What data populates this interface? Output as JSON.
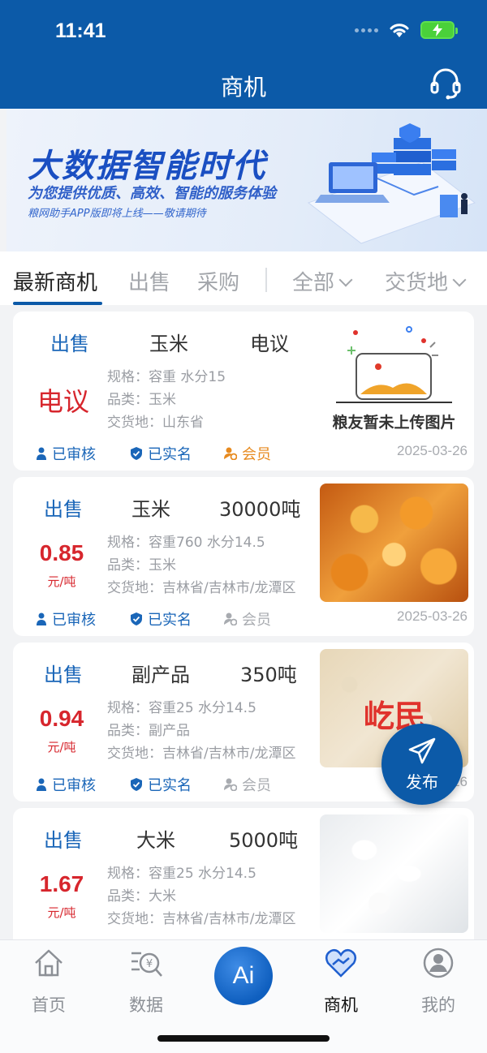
{
  "status_bar": {
    "time": "11:41"
  },
  "header": {
    "title": "商机"
  },
  "banner": {
    "title": "大数据智能时代",
    "subtitle": "为您提供优质、高效、智能的服务体验",
    "note": "粮网助手APP版即将上线——敬请期待"
  },
  "tabs": {
    "latest": "最新商机",
    "sell": "出售",
    "buy": "采购",
    "all": "全部",
    "delivery": "交货地"
  },
  "labels": {
    "spec_prefix": "规格：",
    "category_prefix": "品类：",
    "delivery_prefix": "交货地：",
    "verified": "已审核",
    "real_name": "已实名",
    "member": "会员"
  },
  "cards": [
    {
      "type": "出售",
      "name": "玉米",
      "quantity": "电议",
      "price": "电议",
      "unit": "",
      "spec": "规格：容重 水分15",
      "category": "品类：玉米",
      "delivery": "交货地：山东省",
      "image_caption": "粮友暂未上传图片",
      "verified": "已审核",
      "real_name": "已实名",
      "member": "会员",
      "date": "2025-03-26"
    },
    {
      "type": "出售",
      "name": "玉米",
      "quantity": "30000吨",
      "price": "0.85",
      "unit": "元/吨",
      "spec": "规格：容重760 水分14.5",
      "category": "品类：玉米",
      "delivery": "交货地：吉林省/吉林市/龙潭区",
      "verified": "已审核",
      "real_name": "已实名",
      "member": "会员",
      "date": "2025-03-26"
    },
    {
      "type": "出售",
      "name": "副产品",
      "quantity": "350吨",
      "price": "0.94",
      "unit": "元/吨",
      "spec": "规格：容重25 水分14.5",
      "category": "品类：副产品",
      "delivery": "交货地：吉林省/吉林市/龙潭区",
      "image_watermark": "屹民",
      "verified": "已审核",
      "real_name": "已实名",
      "member": "会员",
      "date": "26"
    },
    {
      "type": "出售",
      "name": "大米",
      "quantity": "5000吨",
      "price": "1.67",
      "unit": "元/吨",
      "spec": "规格：容重25 水分14.5",
      "category": "品类：大米",
      "delivery": "交货地：吉林省/吉林市/龙潭区"
    }
  ],
  "fab": {
    "label": "发布"
  },
  "tabbar": {
    "home": "首页",
    "data": "数据",
    "ai": "Ai",
    "business": "商机",
    "mine": "我的"
  },
  "colors": {
    "primary": "#0c5aa8",
    "price_red": "#d7262d",
    "member_orange": "#e78a1f"
  }
}
